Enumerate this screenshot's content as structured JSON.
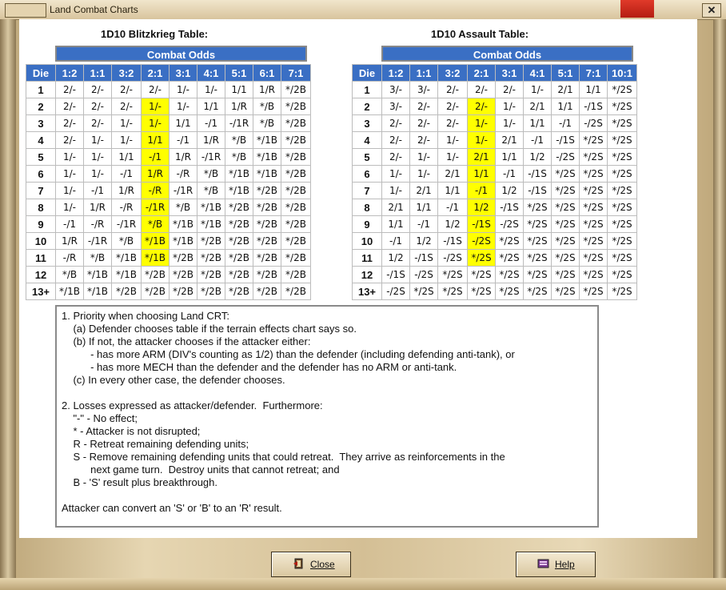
{
  "window": {
    "title": "Land Combat Charts"
  },
  "blitz": {
    "title": "1D10 Blitzkrieg Table:",
    "odds_label": "Combat Odds",
    "columns": [
      "Die",
      "1:2",
      "1:1",
      "3:2",
      "2:1",
      "3:1",
      "4:1",
      "5:1",
      "6:1",
      "7:1"
    ],
    "rows": [
      [
        "1",
        "2/-",
        "2/-",
        "2/-",
        "2/-",
        "1/-",
        "1/-",
        "1/1",
        "1/R",
        "*/2B"
      ],
      [
        "2",
        "2/-",
        "2/-",
        "2/-",
        "1/-",
        "1/-",
        "1/1",
        "1/R",
        "*/B",
        "*/2B"
      ],
      [
        "3",
        "2/-",
        "2/-",
        "1/-",
        "1/-",
        "1/1",
        "-/1",
        "-/1R",
        "*/B",
        "*/2B"
      ],
      [
        "4",
        "2/-",
        "1/-",
        "1/-",
        "1/1",
        "-/1",
        "1/R",
        "*/B",
        "*/1B",
        "*/2B"
      ],
      [
        "5",
        "1/-",
        "1/-",
        "1/1",
        "-/1",
        "1/R",
        "-/1R",
        "*/B",
        "*/1B",
        "*/2B"
      ],
      [
        "6",
        "1/-",
        "1/-",
        "-/1",
        "1/R",
        "-/R",
        "*/B",
        "*/1B",
        "*/1B",
        "*/2B"
      ],
      [
        "7",
        "1/-",
        "-/1",
        "1/R",
        "-/R",
        "-/1R",
        "*/B",
        "*/1B",
        "*/2B",
        "*/2B"
      ],
      [
        "8",
        "1/-",
        "1/R",
        "-/R",
        "-/1R",
        "*/B",
        "*/1B",
        "*/2B",
        "*/2B",
        "*/2B"
      ],
      [
        "9",
        "-/1",
        "-/R",
        "-/1R",
        "*/B",
        "*/1B",
        "*/1B",
        "*/2B",
        "*/2B",
        "*/2B"
      ],
      [
        "10",
        "1/R",
        "-/1R",
        "*/B",
        "*/1B",
        "*/1B",
        "*/2B",
        "*/2B",
        "*/2B",
        "*/2B"
      ],
      [
        "11",
        "-/R",
        "*/B",
        "*/1B",
        "*/1B",
        "*/2B",
        "*/2B",
        "*/2B",
        "*/2B",
        "*/2B"
      ],
      [
        "12",
        "*/B",
        "*/1B",
        "*/1B",
        "*/2B",
        "*/2B",
        "*/2B",
        "*/2B",
        "*/2B",
        "*/2B"
      ],
      [
        "13+",
        "*/1B",
        "*/1B",
        "*/2B",
        "*/2B",
        "*/2B",
        "*/2B",
        "*/2B",
        "*/2B",
        "*/2B"
      ]
    ],
    "highlight_rows": [
      "2",
      "3",
      "4",
      "5",
      "6",
      "7",
      "8",
      "9",
      "10",
      "11"
    ],
    "highlight_col": "2:1",
    "highlight_color": "#ffff00"
  },
  "assault": {
    "title": "1D10 Assault Table:",
    "odds_label": "Combat Odds",
    "columns": [
      "Die",
      "1:2",
      "1:1",
      "3:2",
      "2:1",
      "3:1",
      "4:1",
      "5:1",
      "7:1",
      "10:1"
    ],
    "rows": [
      [
        "1",
        "3/-",
        "3/-",
        "2/-",
        "2/-",
        "2/-",
        "1/-",
        "2/1",
        "1/1",
        "*/2S"
      ],
      [
        "2",
        "3/-",
        "2/-",
        "2/-",
        "2/-",
        "1/-",
        "2/1",
        "1/1",
        "-/1S",
        "*/2S"
      ],
      [
        "3",
        "2/-",
        "2/-",
        "2/-",
        "1/-",
        "1/-",
        "1/1",
        "-/1",
        "-/2S",
        "*/2S"
      ],
      [
        "4",
        "2/-",
        "2/-",
        "1/-",
        "1/-",
        "2/1",
        "-/1",
        "-/1S",
        "*/2S",
        "*/2S"
      ],
      [
        "5",
        "2/-",
        "1/-",
        "1/-",
        "2/1",
        "1/1",
        "1/2",
        "-/2S",
        "*/2S",
        "*/2S"
      ],
      [
        "6",
        "1/-",
        "1/-",
        "2/1",
        "1/1",
        "-/1",
        "-/1S",
        "*/2S",
        "*/2S",
        "*/2S"
      ],
      [
        "7",
        "1/-",
        "2/1",
        "1/1",
        "-/1",
        "1/2",
        "-/1S",
        "*/2S",
        "*/2S",
        "*/2S"
      ],
      [
        "8",
        "2/1",
        "1/1",
        "-/1",
        "1/2",
        "-/1S",
        "*/2S",
        "*/2S",
        "*/2S",
        "*/2S"
      ],
      [
        "9",
        "1/1",
        "-/1",
        "1/2",
        "-/1S",
        "-/2S",
        "*/2S",
        "*/2S",
        "*/2S",
        "*/2S"
      ],
      [
        "10",
        "-/1",
        "1/2",
        "-/1S",
        "-/2S",
        "*/2S",
        "*/2S",
        "*/2S",
        "*/2S",
        "*/2S"
      ],
      [
        "11",
        "1/2",
        "-/1S",
        "-/2S",
        "*/2S",
        "*/2S",
        "*/2S",
        "*/2S",
        "*/2S",
        "*/2S"
      ],
      [
        "12",
        "-/1S",
        "-/2S",
        "*/2S",
        "*/2S",
        "*/2S",
        "*/2S",
        "*/2S",
        "*/2S",
        "*/2S"
      ],
      [
        "13+",
        "-/2S",
        "*/2S",
        "*/2S",
        "*/2S",
        "*/2S",
        "*/2S",
        "*/2S",
        "*/2S",
        "*/2S"
      ]
    ],
    "highlight_rows": [
      "2",
      "3",
      "4",
      "5",
      "6",
      "7",
      "8",
      "9",
      "10",
      "11"
    ],
    "highlight_col": "2:1",
    "highlight_color": "#ffff00"
  },
  "notes": {
    "lines": [
      "1. Priority when choosing Land CRT:",
      "    (a) Defender chooses table if the terrain effects chart says so.",
      "    (b) If not, the attacker chooses if the attacker either:",
      "          - has more ARM (DIV's counting as 1/2) than the defender (including defending anti-tank), or",
      "          - has more MECH than the defender and the defender has no ARM or anti-tank.",
      "    (c) In every other case, the defender chooses.",
      "",
      "2. Losses expressed as attacker/defender.  Furthermore:",
      "    \"-\" - No effect;",
      "    * - Attacker is not disrupted;",
      "    R - Retreat remaining defending units;",
      "    S - Remove remaining defending units that could retreat.  They arrive as reinforcements in the",
      "          next game turn.  Destroy units that cannot retreat; and",
      "    B - 'S' result plus breakthrough.",
      "",
      "Attacker can convert an 'S' or 'B' to an 'R' result."
    ]
  },
  "buttons": {
    "close": "Close",
    "help": "Help"
  }
}
